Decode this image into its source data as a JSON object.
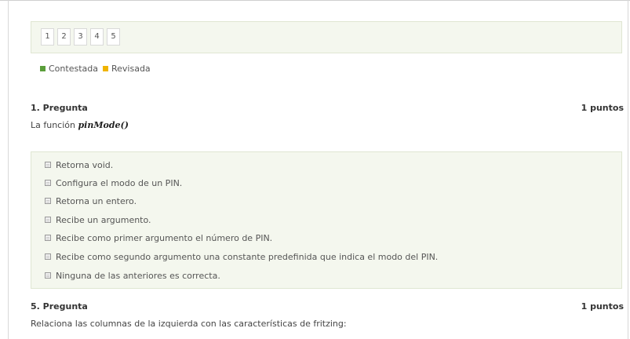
{
  "pagination": {
    "pages": [
      "1",
      "2",
      "3",
      "4",
      "5"
    ]
  },
  "legend": {
    "items": [
      {
        "label": "Contestada",
        "color": "#5a9e3a"
      },
      {
        "label": "Revisada",
        "color": "#f0b400"
      }
    ]
  },
  "questions": [
    {
      "title": "1. Pregunta",
      "points": "1 puntos",
      "text_prefix": "La función ",
      "function_name": "pinMode()",
      "options": [
        "Retorna void.",
        "Configura el modo de un PIN.",
        "Retorna un entero.",
        "Recibe un argumento.",
        "Recibe como primer argumento el número de PIN.",
        "Recibe como segundo argumento una constante predefinida que indica el modo del PIN.",
        "Ninguna de las anteriores es correcta."
      ]
    },
    {
      "title": "5. Pregunta",
      "points": "1 puntos",
      "text": "Relaciona las columnas de la izquierda con las características de fritzing:"
    }
  ]
}
